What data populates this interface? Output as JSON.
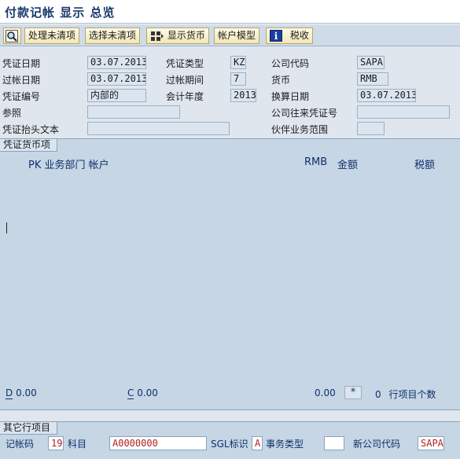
{
  "title": "付款记帐 显示 总览",
  "toolbar": {
    "process_open": "处理未清项",
    "choose_open": "选择未清项",
    "display_currency": "显示货币",
    "account_model": "帐户模型",
    "tax": "税收"
  },
  "header": {
    "doc_date_label": "凭证日期",
    "doc_date": "03.07.2013",
    "doc_type_label": "凭证类型",
    "doc_type": "KZ",
    "company_code_label": "公司代码",
    "company_code": "SAPA",
    "posting_date_label": "过帐日期",
    "posting_date": "03.07.2013",
    "period_label": "过帐期间",
    "period": "7",
    "currency_label": "货币",
    "currency": "RMB",
    "doc_number_label": "凭证编号",
    "doc_number": "内部的",
    "fiscal_year_label": "会计年度",
    "fiscal_year": "2013",
    "translation_date_label": "换算日期",
    "translation_date": "03.07.2013",
    "reference_label": "参照",
    "reference": "",
    "intercompany_label": "公司往来凭证号",
    "intercompany": "",
    "header_text_label": "凭证抬头文本",
    "header_text": "",
    "partner_area_label": "伙伴业务范围",
    "partner_area": ""
  },
  "items_panel": {
    "title": "凭证货币项",
    "col_pk": "PK 业务部门 帐户",
    "col_rmb": "RMB",
    "col_amount": "金额",
    "col_tax": "税额",
    "debit_label": "D",
    "debit_value": "0.00",
    "credit_label": "C",
    "credit_value": "0.00",
    "balance": "0.00",
    "star": "*",
    "item_count": "0",
    "item_count_label": "行项目个数"
  },
  "other_item": {
    "title": "其它行项目",
    "posting_key_label": "记帐码",
    "posting_key": "19",
    "account_label": "科目",
    "account": "A0000000",
    "sgl_label": "SGL标识",
    "sgl": "A",
    "trans_type_label": "事务类型",
    "trans_type": "",
    "new_company_label": "新公司代码",
    "new_company": "SAPA"
  }
}
